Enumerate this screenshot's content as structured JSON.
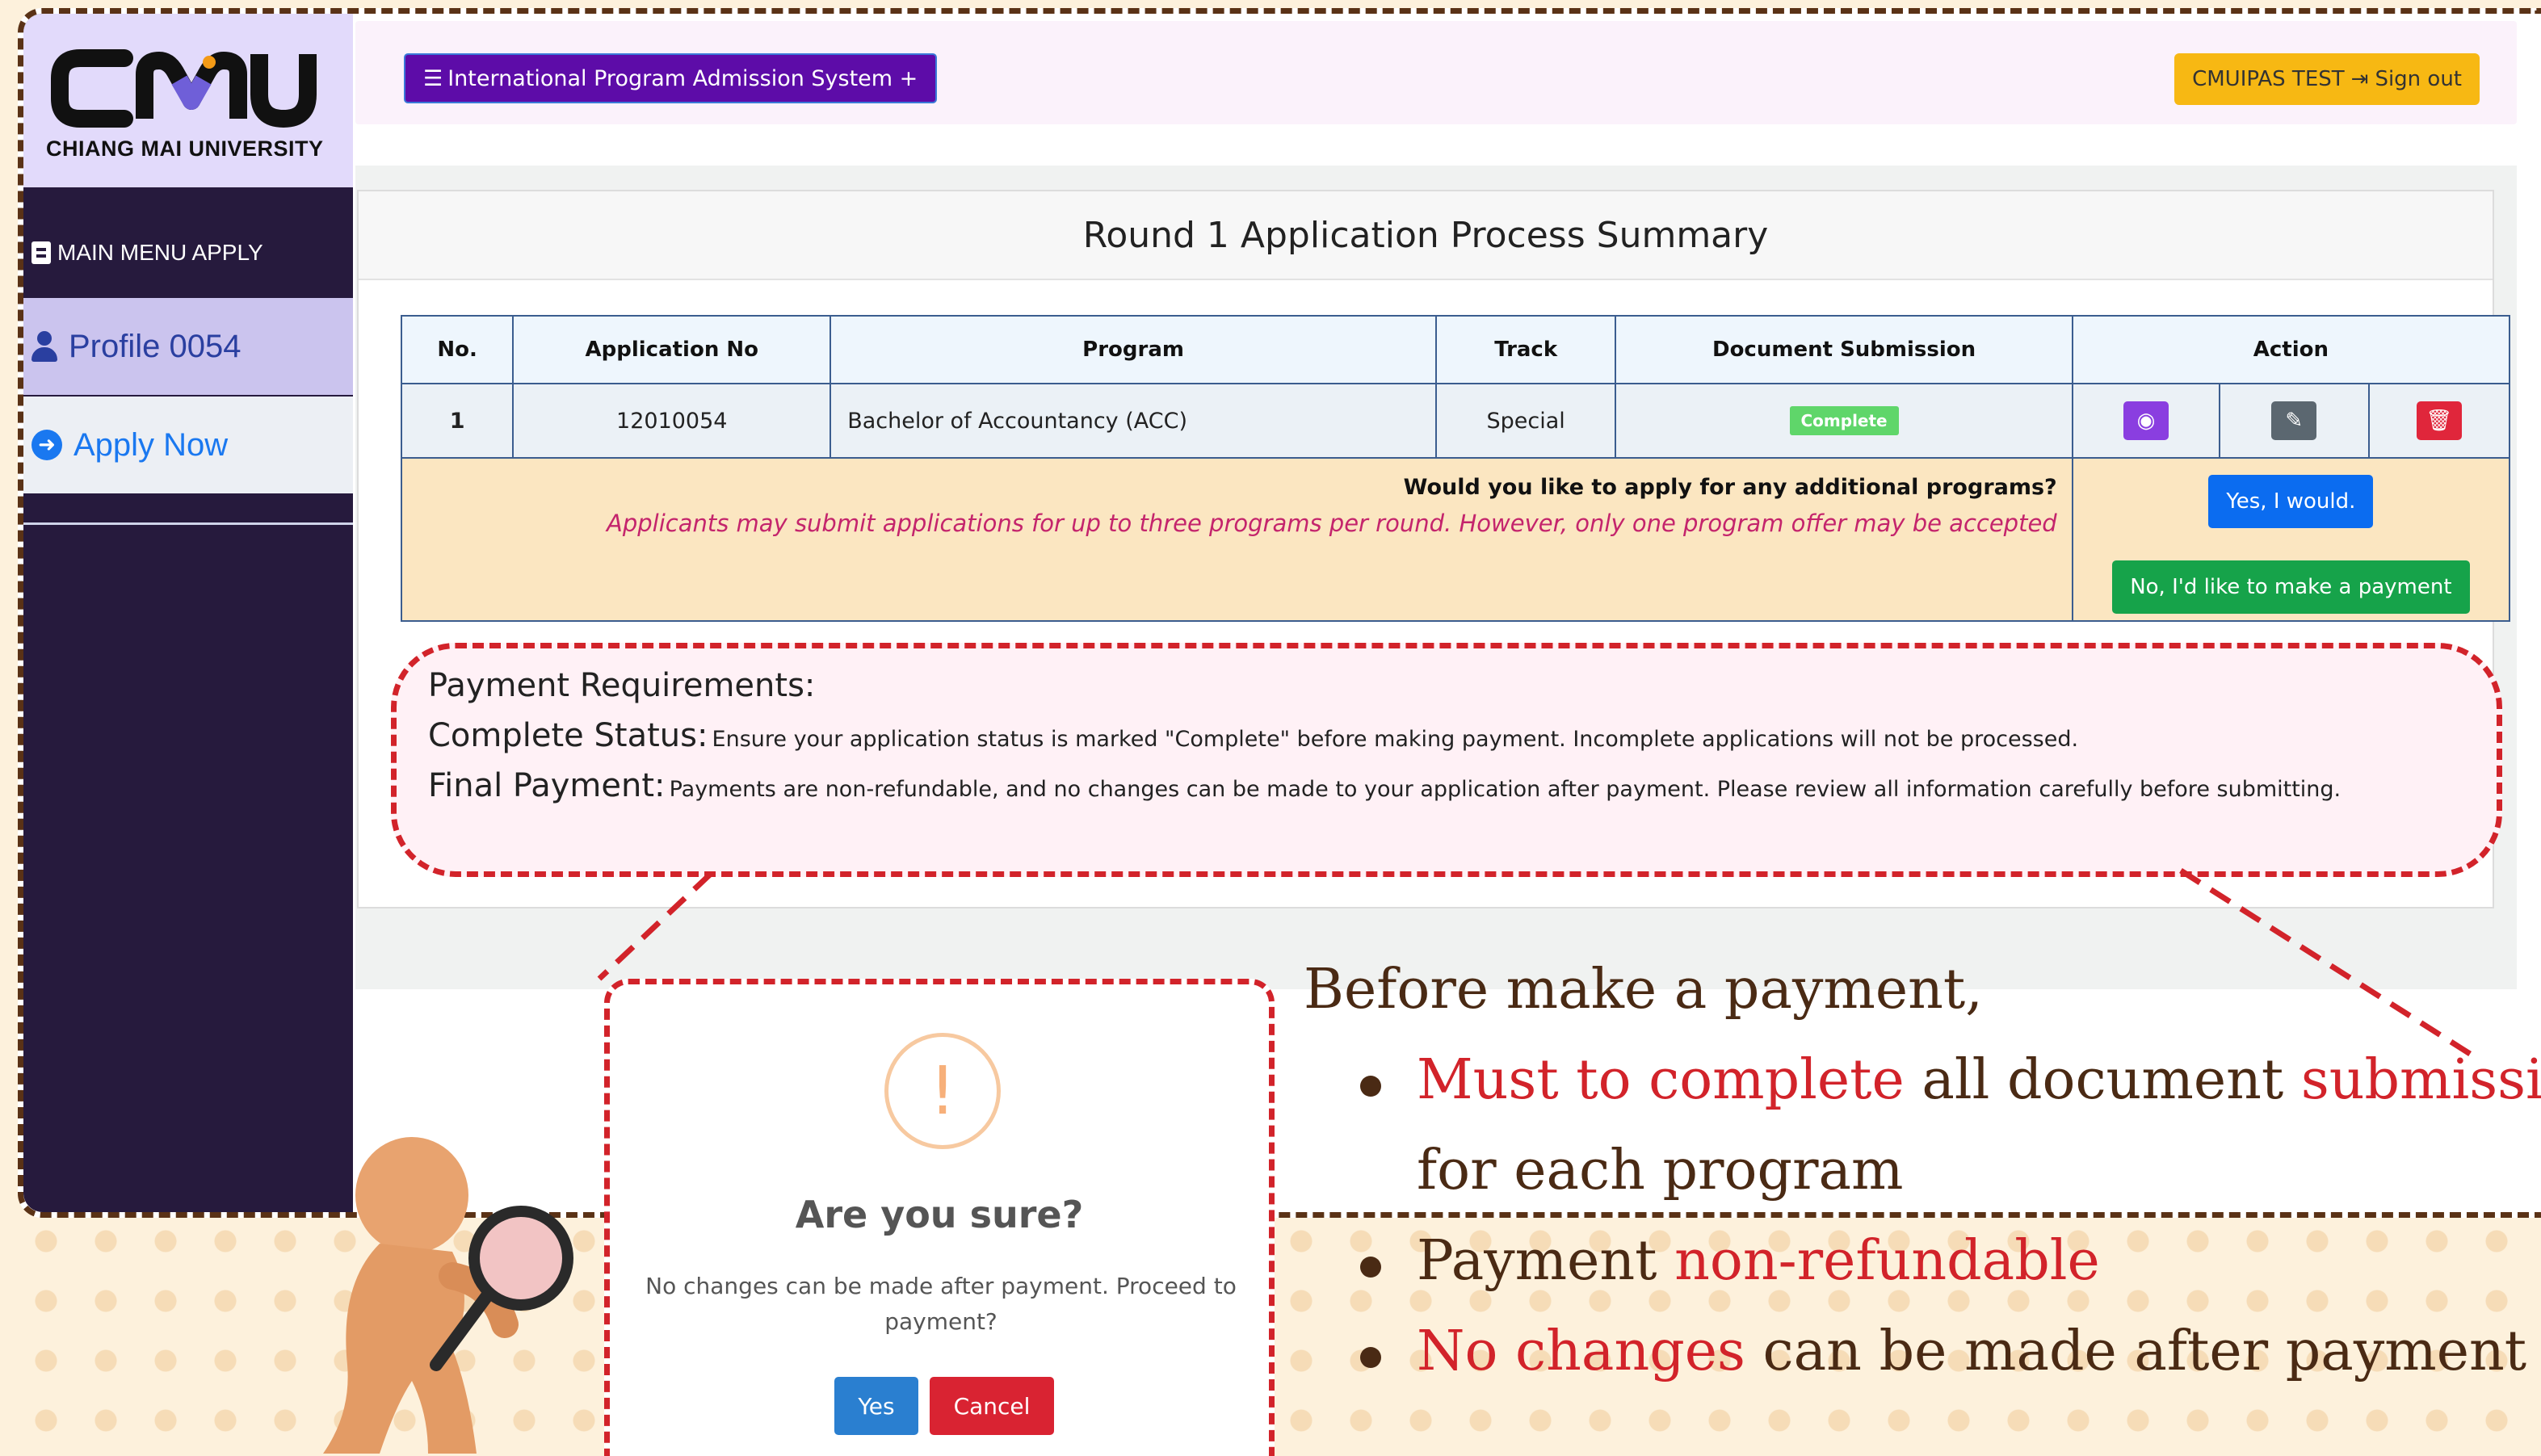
{
  "brand": {
    "logo_text": "CMU",
    "university_name": "CHIANG MAI UNIVERSITY"
  },
  "sidebar": {
    "menu_header": "MAIN MENU APPLY",
    "items": [
      {
        "label": "Profile 0054",
        "icon": "user-icon"
      },
      {
        "label": "Apply Now",
        "icon": "arrow-circle-right-icon"
      }
    ]
  },
  "topbar": {
    "system_button": "International Program Admission System +",
    "user_label": "CMUIPAS TEST",
    "signout_label": "Sign out"
  },
  "summary": {
    "title": "Round 1 Application Process Summary",
    "columns": [
      "No.",
      "Application No",
      "Program",
      "Track",
      "Document Submission",
      "Action"
    ],
    "rows": [
      {
        "no": "1",
        "application_no": "12010054",
        "program": "Bachelor of Accountancy (ACC)",
        "track": "Special",
        "status": "Complete"
      }
    ],
    "additional_question": "Would you like to apply for any additional programs?",
    "additional_note": "Applicants may submit applications for up to three programs per round. However, only one program offer may be accepted",
    "yes_button": "Yes, I would.",
    "pay_button": "No, I'd like to make a payment"
  },
  "requirements": {
    "title": "Payment Requirements:",
    "items": [
      {
        "label": "Complete Status:",
        "text": "Ensure your application status is marked \"Complete\" before making payment. Incomplete applications will not be processed."
      },
      {
        "label": "Final Payment:",
        "text": "Payments are non-refundable, and no changes can be made to your application after payment. Please review all information carefully before submitting."
      }
    ]
  },
  "dialog": {
    "icon": "!",
    "title": "Are you sure?",
    "text": "No changes can be made after payment. Proceed to payment?",
    "confirm": "Yes",
    "cancel": "Cancel"
  },
  "notes": {
    "heading": "Before make a payment,",
    "item1_red1": "Must to complete",
    "item1_mid": " all document ",
    "item1_red2": "submission",
    "item1_cont": "for each program",
    "item2_plain": "Payment ",
    "item2_red": "non-refundable",
    "item3_red": "No changes",
    "item3_plain": " can be made after payment"
  },
  "colors": {
    "accent_red": "#d2232a",
    "sidebar_bg": "#261a3d",
    "system_button": "#5d0ca8",
    "signout_button": "#f7b813"
  }
}
